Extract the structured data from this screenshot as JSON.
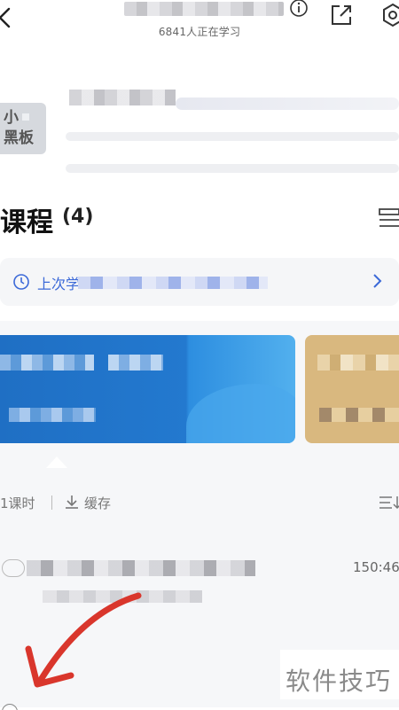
{
  "header": {
    "learners_text": "6841人正在学习"
  },
  "group": {
    "avatar_line1": "小",
    "avatar_line2": "黑板"
  },
  "courses": {
    "title": "课程",
    "count": "(4)"
  },
  "last_study": {
    "label": "上次学"
  },
  "lessons": {
    "count_label": "1课时",
    "cache_label": "缓存",
    "item_time": "150:46"
  },
  "watermark": {
    "text": "软件技巧"
  },
  "colors": {
    "accent": "#3b69d8",
    "annotation_arrow": "#d9362c"
  },
  "icons": [
    "back-icon",
    "info-icon",
    "share-icon",
    "settings-icon",
    "list-icon",
    "clock-icon",
    "chevron-right-icon",
    "download-icon",
    "sort-icon"
  ]
}
